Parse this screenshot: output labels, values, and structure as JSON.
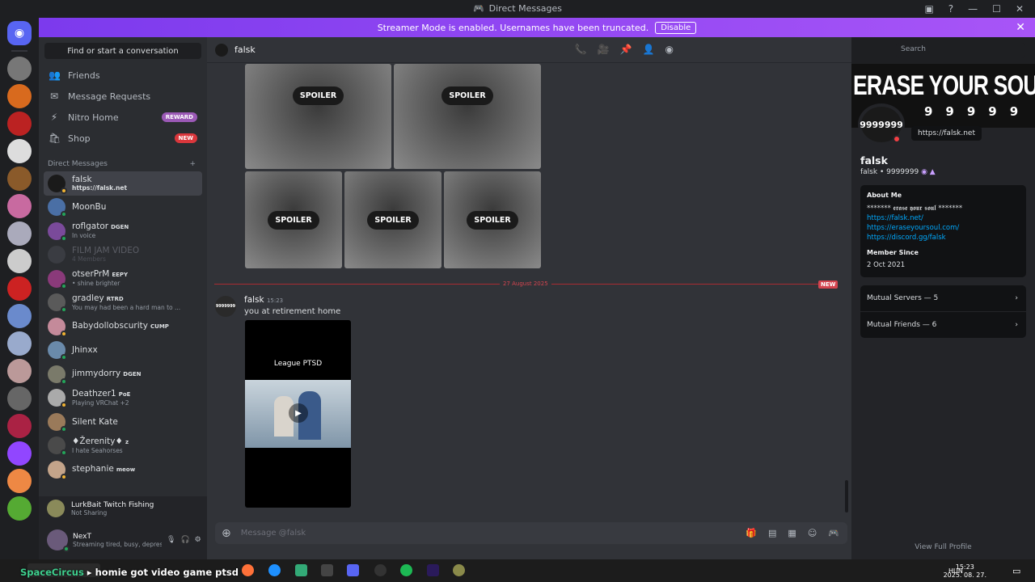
{
  "window": {
    "title": "Direct Messages"
  },
  "banner": {
    "text": "Streamer Mode is enabled. Usernames have been truncated.",
    "button": "Disable"
  },
  "sidebar": {
    "find": "Find or start a conversation",
    "nav": [
      {
        "label": "Friends",
        "icon": "friends-icon"
      },
      {
        "label": "Message Requests",
        "icon": "mail-icon"
      },
      {
        "label": "Nitro Home",
        "icon": "nitro-icon",
        "badge": "REWARD",
        "badge_color": "#9b59b6"
      },
      {
        "label": "Shop",
        "icon": "shop-icon",
        "badge": "NEW",
        "badge_color": "#da373c"
      }
    ],
    "dm_header": "Direct Messages",
    "dms": [
      {
        "name": "falsk",
        "sub": "https://falsk.net",
        "color": "#1a1a1a"
      },
      {
        "name": "MoonBu",
        "sub": "",
        "color": "#4a6fa5"
      },
      {
        "name": "roflgator",
        "tag": "DGEN",
        "sub": "In voice",
        "color": "#7a4a9a"
      },
      {
        "name": "FILM JAM VIDEO",
        "sub": "4 Members",
        "color": "#3a3c42"
      },
      {
        "name": "otserPrM",
        "tag": "EEPY",
        "sub": "• shine brighter",
        "color": "#8a3a7a"
      },
      {
        "name": "gradley",
        "tag": "RTRD",
        "sub": "You may had been a hard man to ...",
        "color": "#5a5a5a"
      },
      {
        "name": "Babydollobscurity",
        "tag": "CUMP",
        "sub": "",
        "color": "#c48a9a"
      },
      {
        "name": "Jhinxx",
        "sub": "",
        "color": "#6a8aaa"
      },
      {
        "name": "jimmydorry",
        "tag": "DGEN",
        "sub": "",
        "color": "#7a7a6a"
      },
      {
        "name": "Deathzer1",
        "tag": "PoE",
        "sub": "Playing VRChat +2",
        "color": "#aaaaaa"
      },
      {
        "name": "Silent Kate",
        "sub": "",
        "color": "#9a7a5a"
      },
      {
        "name": "♦Žerenity♦",
        "tag": "z",
        "sub": "I hate Seahorses",
        "color": "#4a4a4a"
      },
      {
        "name": "stephanie",
        "tag": "meow",
        "sub": "",
        "color": "#c4a48a"
      }
    ],
    "activity": {
      "title": "LurkBait Twitch Fishing",
      "sub": "Not Sharing"
    },
    "user": {
      "name": "NexT",
      "status": "Streaming tired, busy, depresse..."
    }
  },
  "chat": {
    "recipient": "falsk",
    "spoiler_label": "SPOILER",
    "divider_date": "27 August 2025",
    "new_label": "NEW",
    "avatar_text": "9999999",
    "message": {
      "author": "falsk",
      "time": "15:23",
      "text": "you at retirement home"
    },
    "video_caption": "League PTSD",
    "composer_placeholder": "Message @falsk",
    "search_placeholder": "Search"
  },
  "profile": {
    "banner_text": "ERASE YOUR SOUL",
    "banner_nines": "99999",
    "avatar_text": "9999999",
    "tooltip": "https://falsk.net",
    "name": "falsk",
    "username": "falsk • 9999999",
    "about_header": "About Me",
    "about_lines": [
      "******* 𝖊𝖗𝖆𝖘𝖊 𝖞𝖔𝖚𝖗 𝖘𝖔𝖚𝖑 *******"
    ],
    "about_links": [
      "https://falsk.net/",
      "https://eraseyoursoul.com/",
      "https://discord.gg/falsk"
    ],
    "member_since_header": "Member Since",
    "member_since": "2 Oct 2021",
    "mutual_servers": "Mutual Servers — 5",
    "mutual_friends": "Mutual Friends — 6",
    "view_full": "View Full Profile"
  },
  "taskbar": {
    "overlay_prefix": "SpaceCircus",
    "overlay_text": "homie got video game ptsd",
    "lang": "HUN",
    "time": "15:23",
    "date": "2025. 08. 27."
  },
  "colors": {
    "blurple": "#5865f2",
    "accent": "#a855f7",
    "online": "#23a559",
    "dnd": "#f23f43"
  }
}
